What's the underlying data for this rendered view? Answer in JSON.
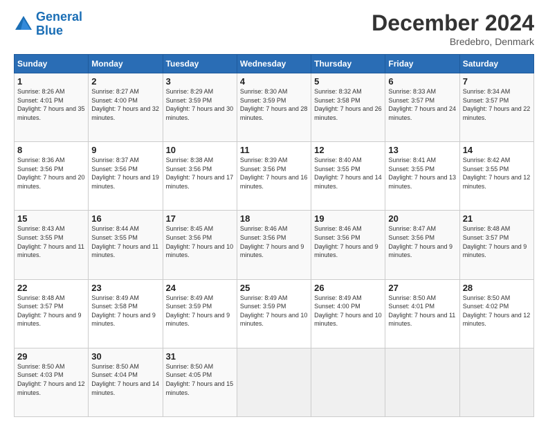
{
  "header": {
    "logo_line1": "General",
    "logo_line2": "Blue",
    "main_title": "December 2024",
    "subtitle": "Bredebro, Denmark"
  },
  "weekdays": [
    "Sunday",
    "Monday",
    "Tuesday",
    "Wednesday",
    "Thursday",
    "Friday",
    "Saturday"
  ],
  "weeks": [
    [
      {
        "day": "1",
        "sunrise": "Sunrise: 8:26 AM",
        "sunset": "Sunset: 4:01 PM",
        "daylight": "Daylight: 7 hours and 35 minutes."
      },
      {
        "day": "2",
        "sunrise": "Sunrise: 8:27 AM",
        "sunset": "Sunset: 4:00 PM",
        "daylight": "Daylight: 7 hours and 32 minutes."
      },
      {
        "day": "3",
        "sunrise": "Sunrise: 8:29 AM",
        "sunset": "Sunset: 3:59 PM",
        "daylight": "Daylight: 7 hours and 30 minutes."
      },
      {
        "day": "4",
        "sunrise": "Sunrise: 8:30 AM",
        "sunset": "Sunset: 3:59 PM",
        "daylight": "Daylight: 7 hours and 28 minutes."
      },
      {
        "day": "5",
        "sunrise": "Sunrise: 8:32 AM",
        "sunset": "Sunset: 3:58 PM",
        "daylight": "Daylight: 7 hours and 26 minutes."
      },
      {
        "day": "6",
        "sunrise": "Sunrise: 8:33 AM",
        "sunset": "Sunset: 3:57 PM",
        "daylight": "Daylight: 7 hours and 24 minutes."
      },
      {
        "day": "7",
        "sunrise": "Sunrise: 8:34 AM",
        "sunset": "Sunset: 3:57 PM",
        "daylight": "Daylight: 7 hours and 22 minutes."
      }
    ],
    [
      {
        "day": "8",
        "sunrise": "Sunrise: 8:36 AM",
        "sunset": "Sunset: 3:56 PM",
        "daylight": "Daylight: 7 hours and 20 minutes."
      },
      {
        "day": "9",
        "sunrise": "Sunrise: 8:37 AM",
        "sunset": "Sunset: 3:56 PM",
        "daylight": "Daylight: 7 hours and 19 minutes."
      },
      {
        "day": "10",
        "sunrise": "Sunrise: 8:38 AM",
        "sunset": "Sunset: 3:56 PM",
        "daylight": "Daylight: 7 hours and 17 minutes."
      },
      {
        "day": "11",
        "sunrise": "Sunrise: 8:39 AM",
        "sunset": "Sunset: 3:56 PM",
        "daylight": "Daylight: 7 hours and 16 minutes."
      },
      {
        "day": "12",
        "sunrise": "Sunrise: 8:40 AM",
        "sunset": "Sunset: 3:55 PM",
        "daylight": "Daylight: 7 hours and 14 minutes."
      },
      {
        "day": "13",
        "sunrise": "Sunrise: 8:41 AM",
        "sunset": "Sunset: 3:55 PM",
        "daylight": "Daylight: 7 hours and 13 minutes."
      },
      {
        "day": "14",
        "sunrise": "Sunrise: 8:42 AM",
        "sunset": "Sunset: 3:55 PM",
        "daylight": "Daylight: 7 hours and 12 minutes."
      }
    ],
    [
      {
        "day": "15",
        "sunrise": "Sunrise: 8:43 AM",
        "sunset": "Sunset: 3:55 PM",
        "daylight": "Daylight: 7 hours and 11 minutes."
      },
      {
        "day": "16",
        "sunrise": "Sunrise: 8:44 AM",
        "sunset": "Sunset: 3:55 PM",
        "daylight": "Daylight: 7 hours and 11 minutes."
      },
      {
        "day": "17",
        "sunrise": "Sunrise: 8:45 AM",
        "sunset": "Sunset: 3:56 PM",
        "daylight": "Daylight: 7 hours and 10 minutes."
      },
      {
        "day": "18",
        "sunrise": "Sunrise: 8:46 AM",
        "sunset": "Sunset: 3:56 PM",
        "daylight": "Daylight: 7 hours and 9 minutes."
      },
      {
        "day": "19",
        "sunrise": "Sunrise: 8:46 AM",
        "sunset": "Sunset: 3:56 PM",
        "daylight": "Daylight: 7 hours and 9 minutes."
      },
      {
        "day": "20",
        "sunrise": "Sunrise: 8:47 AM",
        "sunset": "Sunset: 3:56 PM",
        "daylight": "Daylight: 7 hours and 9 minutes."
      },
      {
        "day": "21",
        "sunrise": "Sunrise: 8:48 AM",
        "sunset": "Sunset: 3:57 PM",
        "daylight": "Daylight: 7 hours and 9 minutes."
      }
    ],
    [
      {
        "day": "22",
        "sunrise": "Sunrise: 8:48 AM",
        "sunset": "Sunset: 3:57 PM",
        "daylight": "Daylight: 7 hours and 9 minutes."
      },
      {
        "day": "23",
        "sunrise": "Sunrise: 8:49 AM",
        "sunset": "Sunset: 3:58 PM",
        "daylight": "Daylight: 7 hours and 9 minutes."
      },
      {
        "day": "24",
        "sunrise": "Sunrise: 8:49 AM",
        "sunset": "Sunset: 3:59 PM",
        "daylight": "Daylight: 7 hours and 9 minutes."
      },
      {
        "day": "25",
        "sunrise": "Sunrise: 8:49 AM",
        "sunset": "Sunset: 3:59 PM",
        "daylight": "Daylight: 7 hours and 10 minutes."
      },
      {
        "day": "26",
        "sunrise": "Sunrise: 8:49 AM",
        "sunset": "Sunset: 4:00 PM",
        "daylight": "Daylight: 7 hours and 10 minutes."
      },
      {
        "day": "27",
        "sunrise": "Sunrise: 8:50 AM",
        "sunset": "Sunset: 4:01 PM",
        "daylight": "Daylight: 7 hours and 11 minutes."
      },
      {
        "day": "28",
        "sunrise": "Sunrise: 8:50 AM",
        "sunset": "Sunset: 4:02 PM",
        "daylight": "Daylight: 7 hours and 12 minutes."
      }
    ],
    [
      {
        "day": "29",
        "sunrise": "Sunrise: 8:50 AM",
        "sunset": "Sunset: 4:03 PM",
        "daylight": "Daylight: 7 hours and 12 minutes."
      },
      {
        "day": "30",
        "sunrise": "Sunrise: 8:50 AM",
        "sunset": "Sunset: 4:04 PM",
        "daylight": "Daylight: 7 hours and 14 minutes."
      },
      {
        "day": "31",
        "sunrise": "Sunrise: 8:50 AM",
        "sunset": "Sunset: 4:05 PM",
        "daylight": "Daylight: 7 hours and 15 minutes."
      },
      null,
      null,
      null,
      null
    ]
  ]
}
